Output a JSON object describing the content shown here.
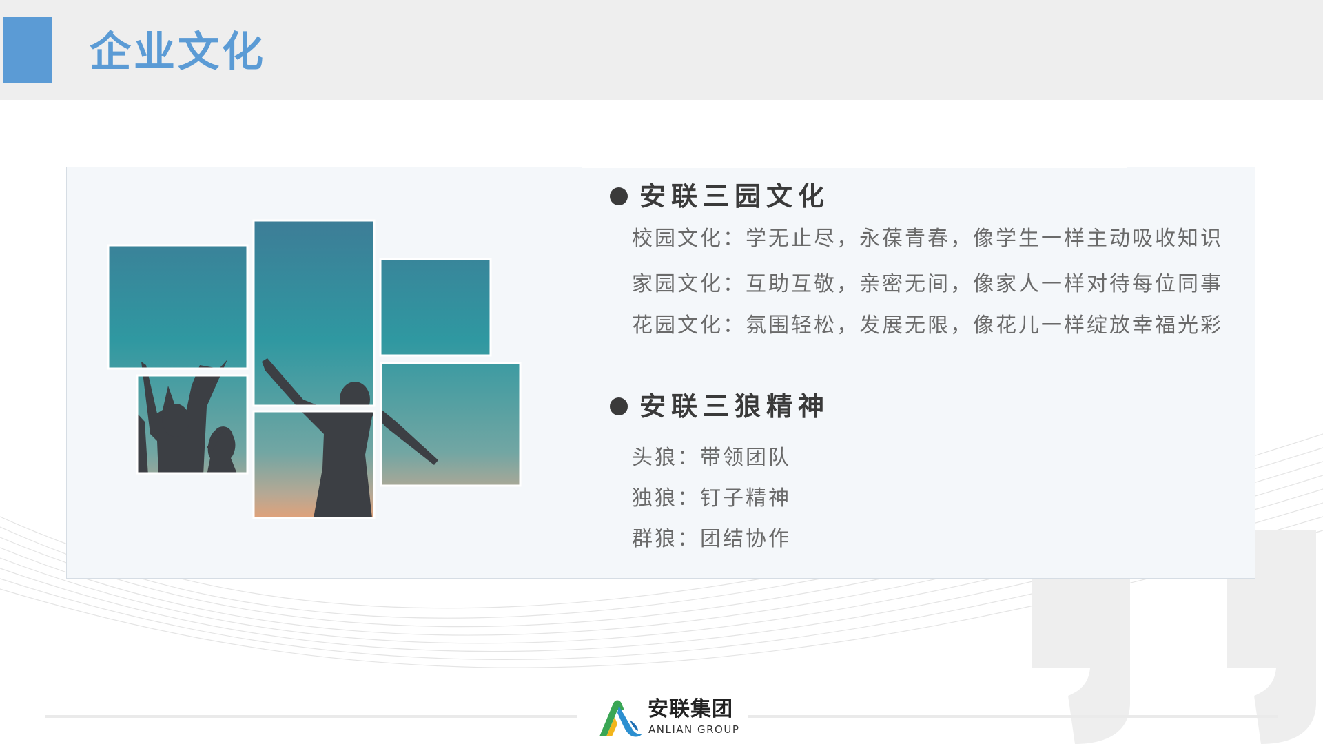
{
  "page": {
    "title": "企业文化"
  },
  "section_three_gardens": {
    "heading": "安联三园文化",
    "lines": [
      "校园文化：学无止尽，永葆青春，像学生一样主动吸收知识",
      "家园文化：互助互敬，亲密无间，像家人一样对待每位同事",
      "花园文化：氛围轻松，发展无限，像花儿一样绽放幸福光彩"
    ]
  },
  "section_three_wolves": {
    "heading": "安联三狼精神",
    "lines": [
      "头狼：带领团队",
      "独狼：钉子精神",
      "群狼：团结协作"
    ]
  },
  "footer": {
    "brand_cn": "安联集团",
    "brand_en": "ANLIAN GROUP"
  },
  "colors": {
    "accent": "#5b9bd5",
    "header_band": "#eeeeee",
    "panel_bg": "#f4f7fa",
    "heading_text": "#3a3a3a",
    "body_text": "#6a6a6a",
    "photo_top": "#2e8595",
    "photo_bottom": "#6fa39f",
    "silhouette": "#3c3f44"
  },
  "icons": [
    "bullet-dot",
    "anlian-logo-mark",
    "quote-mark"
  ]
}
